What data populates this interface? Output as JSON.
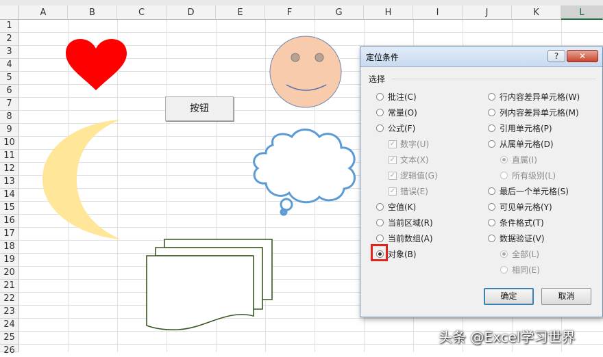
{
  "sheet": {
    "columns": [
      "A",
      "B",
      "C",
      "D",
      "E",
      "F",
      "G",
      "H",
      "I",
      "J",
      "K",
      "L"
    ],
    "selected_column": "L",
    "rows": [
      "1",
      "2",
      "3",
      "4",
      "5",
      "6",
      "7",
      "8",
      "9",
      "10",
      "11",
      "12",
      "13",
      "14",
      "15",
      "16",
      "17",
      "18",
      "19",
      "20",
      "21",
      "22",
      "23",
      "24",
      "25",
      "26"
    ],
    "button_label": "按钮"
  },
  "shapes": {
    "heart_color": "#ff0000",
    "face_fill": "#f8cbad",
    "moon_fill": "#ffe699",
    "cloud_stroke": "#5b9bd5",
    "document_stroke": "#375623"
  },
  "dialog": {
    "title": "定位条件",
    "help_label": "?",
    "close_label": "✕",
    "group_label": "选择",
    "left_options": [
      {
        "label": "批注(C)"
      },
      {
        "label": "常量(O)"
      },
      {
        "label": "公式(F)"
      },
      {
        "label": "数字(U)"
      },
      {
        "label": "文本(X)"
      },
      {
        "label": "逻辑值(G)"
      },
      {
        "label": "错误(E)"
      },
      {
        "label": "空值(K)"
      },
      {
        "label": "当前区域(R)"
      },
      {
        "label": "当前数组(A)"
      },
      {
        "label": "对象(B)"
      }
    ],
    "right_options": [
      {
        "label": "行内容差异单元格(W)"
      },
      {
        "label": "列内容差异单元格(M)"
      },
      {
        "label": "引用单元格(P)"
      },
      {
        "label": "从属单元格(D)"
      },
      {
        "label": "直属(I)"
      },
      {
        "label": "所有级别(L)"
      },
      {
        "label": "最后一个单元格(S)"
      },
      {
        "label": "可见单元格(Y)"
      },
      {
        "label": "条件格式(T)"
      },
      {
        "label": "数据验证(V)"
      },
      {
        "label": "全部(L)"
      },
      {
        "label": "相同(E)"
      }
    ],
    "selected_option": "对象(B)",
    "ok_label": "确定",
    "cancel_label": "取消",
    "highlight_color": "#e0241b"
  },
  "watermark": "头条 @Excel学习世界"
}
